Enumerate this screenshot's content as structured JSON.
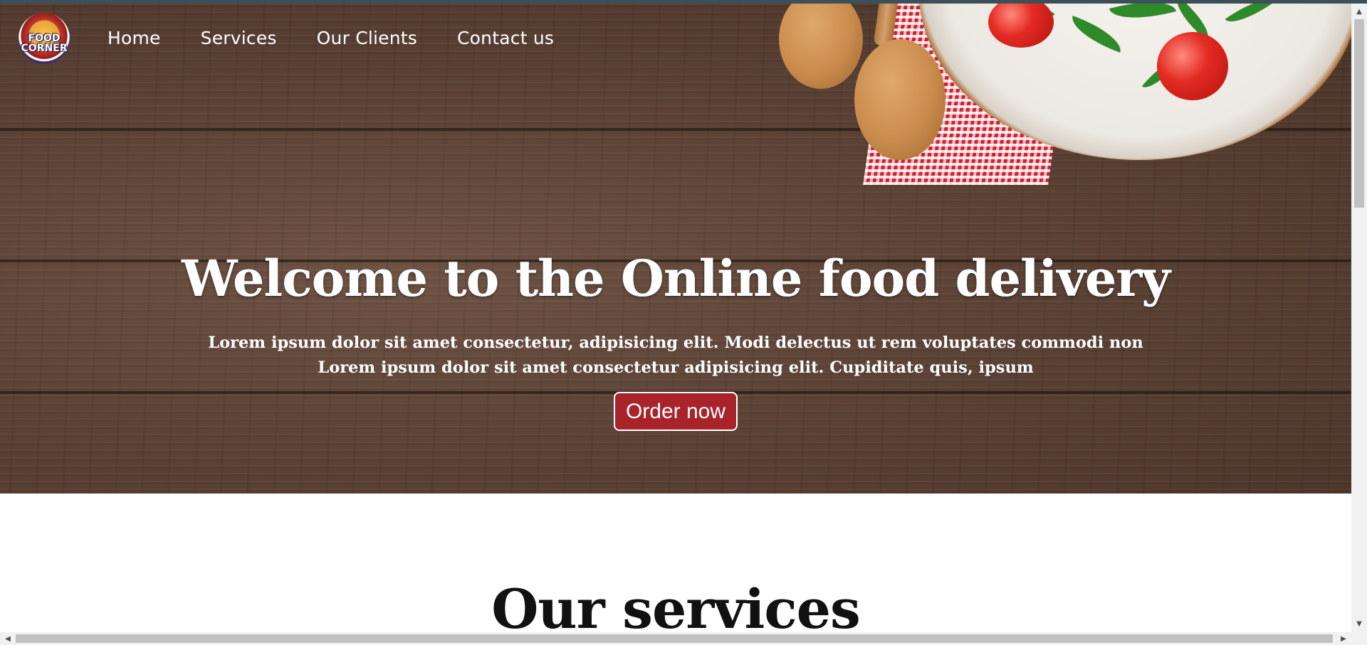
{
  "logo": {
    "text_line1": "FOOD",
    "text_line2": "CORNER"
  },
  "nav": {
    "items": [
      {
        "label": "Home"
      },
      {
        "label": "Services"
      },
      {
        "label": "Our Clients"
      },
      {
        "label": "Contact us"
      }
    ]
  },
  "hero": {
    "title": "Welcome to the Online food delivery",
    "subtitle_line1": "Lorem ipsum dolor sit amet consectetur, adipisicing elit. Modi delectus ut rem voluptates commodi non",
    "subtitle_line2": "Lorem ipsum dolor sit amet consectetur adipisicing elit. Cupiditate quis, ipsum",
    "cta_label": "Order now",
    "cta_color": "#a8232a"
  },
  "services": {
    "title": "Our services"
  },
  "scrollbars": {
    "up_arrow": "▲",
    "down_arrow": "▼",
    "left_arrow": "◀",
    "right_arrow": "▶"
  }
}
